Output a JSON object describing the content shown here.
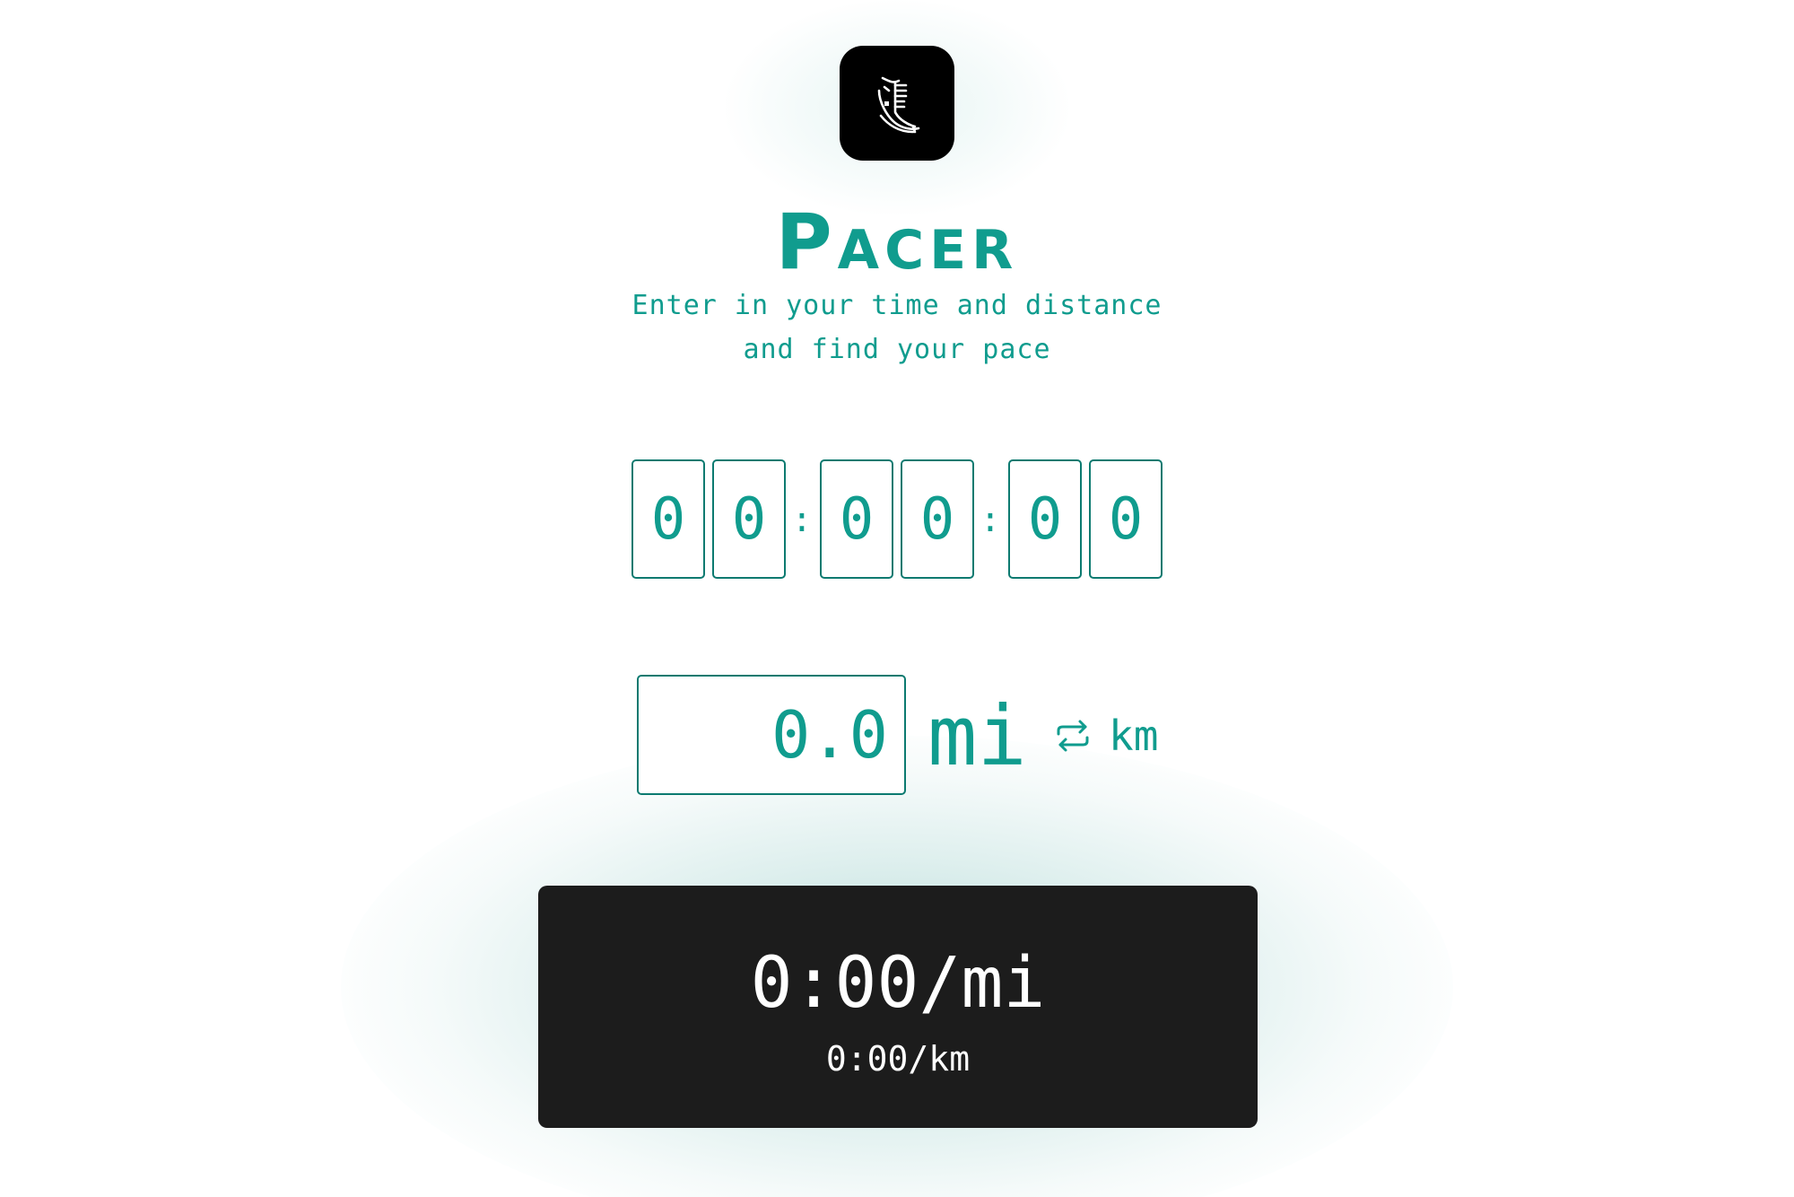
{
  "app": {
    "title": "Pacer",
    "subtitle_line1": "Enter in your time and distance",
    "subtitle_line2": "and find your pace",
    "logo_icon": "running-shoe-icon",
    "accent_color": "#109c8e",
    "dark_color": "#1c1c1c"
  },
  "time": {
    "hours": [
      "0",
      "0"
    ],
    "minutes": [
      "0",
      "0"
    ],
    "seconds": [
      "0",
      "0"
    ],
    "separator": ":"
  },
  "distance": {
    "value": "0.0",
    "unit": "mi",
    "alt_unit": "km",
    "swap_icon": "swap-arrows-icon"
  },
  "result": {
    "pace_primary": "0:00/mi",
    "pace_secondary": "0:00/km"
  }
}
